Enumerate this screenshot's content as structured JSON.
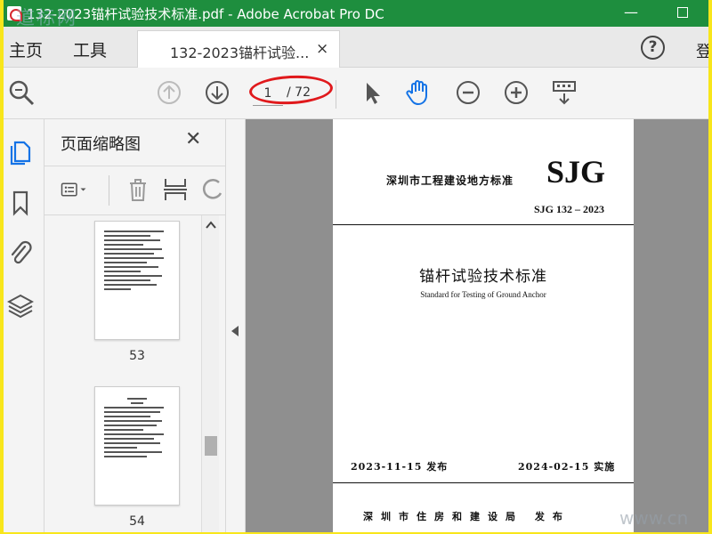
{
  "window": {
    "title": "132-2023锚杆试验技术标准.pdf - Adobe Acrobat Pro DC",
    "watermark_top_left": "道标网",
    "minimize_label": "—"
  },
  "tabs": {
    "home": "主页",
    "tools": "工具",
    "document": "132-2023锚杆试验...",
    "close_glyph": "×",
    "help_glyph": "?",
    "signin": "登"
  },
  "toolbar": {
    "current_page": "1",
    "total_pages": "/ 72"
  },
  "thumbnail_panel": {
    "title": "页面缩略图",
    "close_glyph": "✕",
    "thumbnails": [
      {
        "label": "53"
      },
      {
        "label": "54"
      }
    ]
  },
  "document_page": {
    "org": "深圳市工程建设地方标准",
    "series": "SJG",
    "code": "SJG 132 – 2023",
    "title_cn": "锚杆试验技术标准",
    "title_en": "Standard for Testing of Ground Anchor",
    "issue_date": "2023-11-15 发布",
    "effective_date": "2024-02-15 实施",
    "issuer": "深圳市住房和建设局 发布"
  },
  "watermark_bottom_right": "www.cn",
  "colors": {
    "title_bar": "#1e8e3e",
    "outer_border": "#f8e61b",
    "annotation": "#e0191c",
    "hand_tool_active": "#1473e6"
  }
}
